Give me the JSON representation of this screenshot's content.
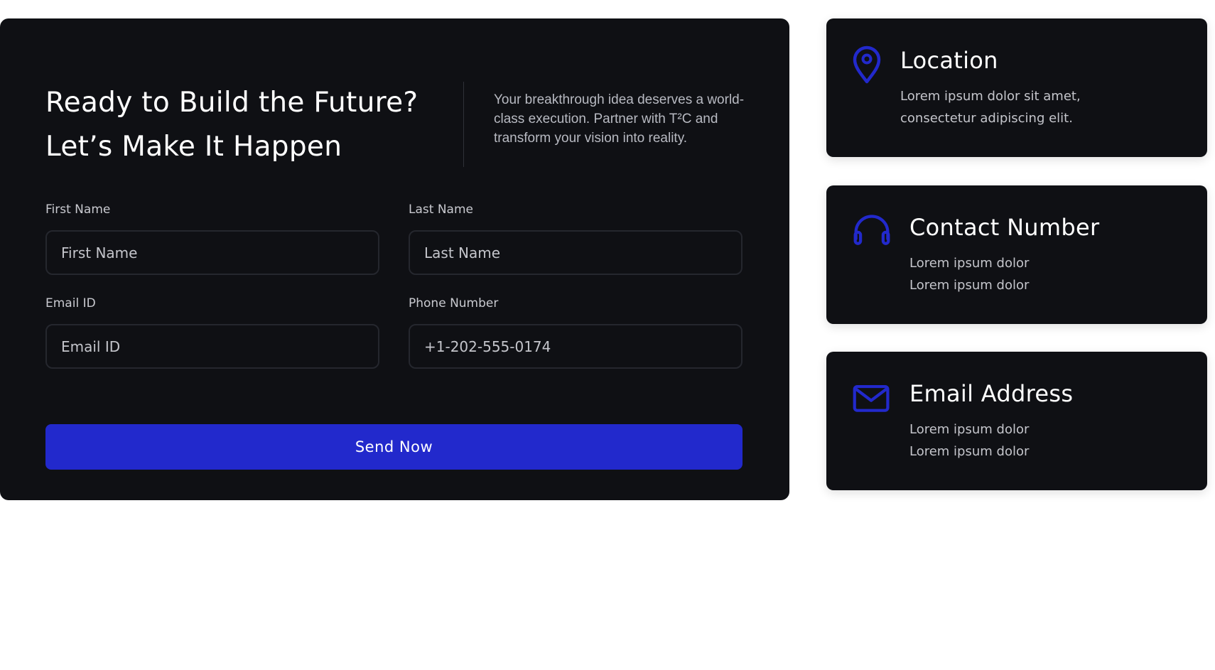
{
  "colors": {
    "accent": "#2229cc",
    "panel_background": "#0f1014",
    "page_background": "#ffffff"
  },
  "contact_form": {
    "headline_line1": "Ready to Build the Future?",
    "headline_line2": "Let’s Make It Happen",
    "intro": "Your breakthrough idea deserves a world-class execution. Partner with T²C and transform your vision into reality.",
    "fields": [
      {
        "label": "First Name",
        "placeholder": "First Name",
        "value": ""
      },
      {
        "label": "Last Name",
        "placeholder": "Last Name",
        "value": ""
      },
      {
        "label": "Email ID",
        "placeholder": "Email ID",
        "value": ""
      },
      {
        "label": "Phone Number",
        "placeholder": "+1-202-555-0174",
        "value": ""
      }
    ],
    "submit_label": "Send Now"
  },
  "info_cards": [
    {
      "icon": "location-pin-icon",
      "title": "Location",
      "lines": [
        "Lorem ipsum dolor sit amet,",
        "consectetur adipiscing elit."
      ]
    },
    {
      "icon": "headphones-icon",
      "title": "Contact Number",
      "lines": [
        "Lorem ipsum dolor",
        "Lorem ipsum dolor"
      ]
    },
    {
      "icon": "envelope-icon",
      "title": "Email Address",
      "lines": [
        "Lorem ipsum dolor",
        "Lorem ipsum dolor"
      ]
    }
  ]
}
